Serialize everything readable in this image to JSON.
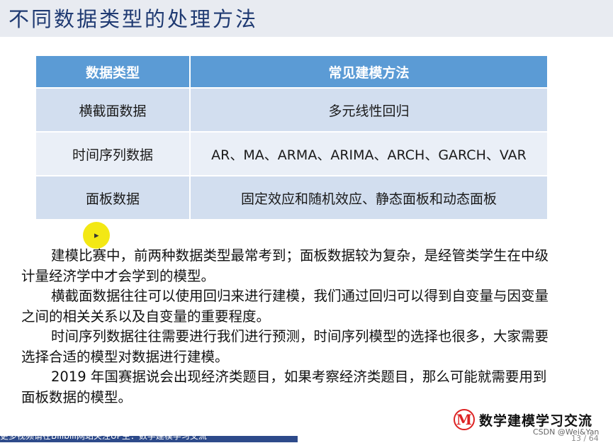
{
  "slide": {
    "title": "不同数据类型的处理方法",
    "table": {
      "headers": [
        "数据类型",
        "常见建模方法"
      ],
      "rows": [
        [
          "横截面数据",
          "多元线性回归"
        ],
        [
          "时间序列数据",
          "AR、MA、ARMA、ARIMA、ARCH、GARCH、VAR"
        ],
        [
          "面板数据",
          "固定效应和随机效应、静态面板和动态面板"
        ]
      ]
    },
    "paragraphs": [
      "建模比赛中，前两种数据类型最常考到；面板数据较为复杂，是经管类学生在中级计量经济学中才会学到的模型。",
      "横截面数据往往可以使用回归来进行建模，我们通过回归可以得到自变量与因变量之间的相关关系以及自变量的重要程度。",
      "时间序列数据往往需要进行我们进行预测，时间序列模型的选择也很多，大家需要选择合适的模型对数据进行建模。",
      "2019 年国赛据说会出现经济类题目，如果考察经济类题目，那么可能就需要用到面板数据的模型。"
    ],
    "brand": {
      "logo_letter": "M",
      "name": "数学建模学习交流"
    },
    "footer_text": "更多视频请在Bilibili网站关注UP主：数学建模学习交流",
    "page_number": "13 / 64"
  },
  "watermark": "CSDN @Wei&Yan",
  "colors": {
    "header_bg": "#e8ebf1",
    "title": "#1f3a72",
    "table_header": "#5b9bd5",
    "row_dark": "#d2deef",
    "row_light": "#eaeff7",
    "logo_red": "#dd2222",
    "footer_bar": "#2d4a8a",
    "cursor_highlight": "#f2e600"
  },
  "icons": {
    "cursor": "mouse-pointer-icon",
    "logo": "brand-m-logo-icon"
  }
}
